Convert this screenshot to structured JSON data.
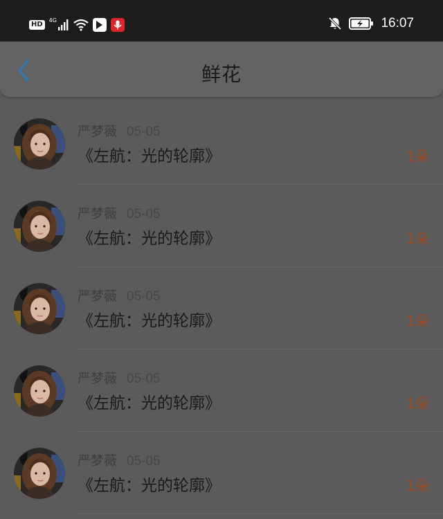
{
  "status_bar": {
    "hd_label": "HD",
    "network_label": "4G",
    "time": "16:07"
  },
  "header": {
    "title": "鲜花",
    "back_icon": "chevron-left-icon"
  },
  "colors": {
    "accent": "#2f77b5",
    "count": "#a04a21"
  },
  "list": {
    "items": [
      {
        "user": "严梦薇",
        "date": "05-05",
        "book": "《左航：光的轮廓》",
        "count": "1朵"
      },
      {
        "user": "严梦薇",
        "date": "05-05",
        "book": "《左航：光的轮廓》",
        "count": "1朵"
      },
      {
        "user": "严梦薇",
        "date": "05-05",
        "book": "《左航：光的轮廓》",
        "count": "1朵"
      },
      {
        "user": "严梦薇",
        "date": "05-05",
        "book": "《左航：光的轮廓》",
        "count": "1朵"
      },
      {
        "user": "严梦薇",
        "date": "05-05",
        "book": "《左航：光的轮廓》",
        "count": "1朵"
      }
    ]
  }
}
